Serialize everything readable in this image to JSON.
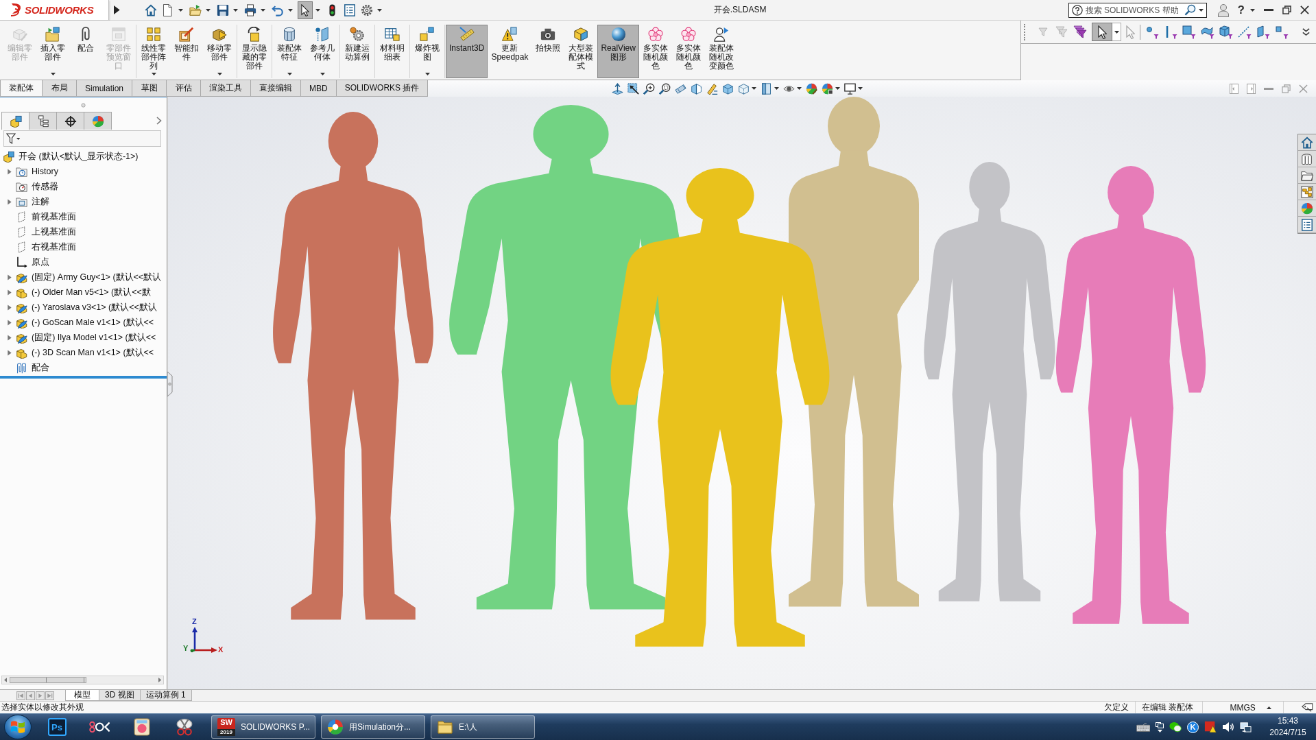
{
  "title_bar": {
    "logo": "SOLIDWORKS",
    "quick_access": [
      {
        "dropdown": false,
        "on": false
      },
      {
        "dropdown": true,
        "on": false
      },
      {
        "dropdown": true,
        "on": false
      },
      {
        "dropdown": true,
        "on": false
      },
      {
        "dropdown": true,
        "on": false
      },
      {
        "dropdown": true,
        "on": false
      },
      {
        "dropdown": true,
        "on": true
      },
      {
        "dropdown": false,
        "on": false
      },
      {
        "dropdown": false,
        "on": false
      },
      {
        "dropdown": true,
        "on": false
      }
    ],
    "title": "开会.SLDASM",
    "search": {
      "placeholder": "搜索 SOLIDWORKS 帮助"
    },
    "help": "?"
  },
  "command_manager": {
    "groups": [
      {
        "buttons": [
          {
            "label": "编辑零部件",
            "disabled": true,
            "dropdown": false,
            "on": false
          },
          {
            "label": "插入零部件",
            "disabled": false,
            "dropdown": true,
            "on": false
          },
          {
            "label": "配合",
            "disabled": false,
            "dropdown": false,
            "on": false
          },
          {
            "label": "零部件预览窗口",
            "disabled": true,
            "dropdown": false,
            "on": false
          }
        ]
      },
      {
        "buttons": [
          {
            "label": "线性零部件阵列",
            "disabled": false,
            "dropdown": true,
            "on": false
          },
          {
            "label": "智能扣件",
            "disabled": false,
            "dropdown": false,
            "on": false
          },
          {
            "label": "移动零部件",
            "disabled": false,
            "dropdown": true,
            "on": false
          }
        ]
      },
      {
        "buttons": [
          {
            "label": "显示隐藏的零部件",
            "disabled": false,
            "dropdown": false,
            "on": false
          }
        ]
      },
      {
        "buttons": [
          {
            "label": "装配体特征",
            "disabled": false,
            "dropdown": true,
            "on": false
          },
          {
            "label": "参考几何体",
            "disabled": false,
            "dropdown": true,
            "on": false
          }
        ]
      },
      {
        "buttons": [
          {
            "label": "新建运动算例",
            "disabled": false,
            "dropdown": false,
            "on": false
          }
        ]
      },
      {
        "buttons": [
          {
            "label": "材料明细表",
            "disabled": false,
            "dropdown": false,
            "on": false
          }
        ]
      },
      {
        "buttons": [
          {
            "label": "爆炸视图",
            "disabled": false,
            "dropdown": true,
            "on": false
          }
        ]
      },
      {
        "buttons": [
          {
            "label": "Instant3D",
            "disabled": false,
            "dropdown": false,
            "on": true
          },
          {
            "label": "更新Speedpak",
            "disabled": false,
            "dropdown": false,
            "on": false
          },
          {
            "label": "拍快照",
            "disabled": false,
            "dropdown": false,
            "on": false
          },
          {
            "label": "大型装配体模式",
            "disabled": false,
            "dropdown": false,
            "on": false
          },
          {
            "label": "RealView图形",
            "disabled": false,
            "dropdown": false,
            "on": true
          },
          {
            "label": "多实体随机颜色",
            "disabled": false,
            "dropdown": false,
            "on": false
          },
          {
            "label": "多实体随机颜色",
            "disabled": false,
            "dropdown": false,
            "on": false
          },
          {
            "label": "装配体随机改变颜色",
            "disabled": false,
            "dropdown": false,
            "on": false
          }
        ]
      }
    ],
    "tabs": [
      {
        "label": "装配体",
        "selected": true
      },
      {
        "label": "布局",
        "selected": false
      },
      {
        "label": "Simulation",
        "selected": false
      },
      {
        "label": "草图",
        "selected": false
      },
      {
        "label": "评估",
        "selected": false
      },
      {
        "label": "渲染工具",
        "selected": false
      },
      {
        "label": "直接编辑",
        "selected": false
      },
      {
        "label": "MBD",
        "selected": false
      },
      {
        "label": "SOLIDWORKS 插件",
        "selected": false
      }
    ]
  },
  "selection_filter": {
    "buttons": [
      {
        "disabled": true,
        "on": false,
        "dropdown": false
      },
      {
        "disabled": true,
        "on": false,
        "dropdown": false
      },
      {
        "disabled": false,
        "on": false,
        "dropdown": false
      },
      {
        "disabled": false,
        "on": true,
        "dropdown": true
      },
      {
        "disabled": true,
        "on": false,
        "dropdown": false
      },
      {
        "disabled": false,
        "on": false,
        "dropdown": false
      },
      {
        "disabled": false,
        "on": false,
        "dropdown": false
      },
      {
        "disabled": false,
        "on": false,
        "dropdown": false
      },
      {
        "disabled": false,
        "on": false,
        "dropdown": false
      },
      {
        "disabled": false,
        "on": false,
        "dropdown": false
      },
      {
        "disabled": false,
        "on": false,
        "dropdown": false
      },
      {
        "disabled": false,
        "on": false,
        "dropdown": false
      },
      {
        "disabled": false,
        "on": false,
        "dropdown": false
      }
    ]
  },
  "view_toolbar": {
    "buttons": [
      {
        "dropdown": false
      },
      {
        "dropdown": false
      },
      {
        "dropdown": false
      },
      {
        "dropdown": false
      },
      {
        "dropdown": false
      },
      {
        "dropdown": false
      },
      {
        "dropdown": false
      },
      {
        "dropdown": false
      },
      {
        "dropdown": true
      },
      {
        "dropdown": true
      },
      {
        "dropdown": true
      },
      {
        "dropdown": false
      },
      {
        "dropdown": true
      },
      {
        "dropdown": true
      }
    ]
  },
  "feature_manager": {
    "tabs": [
      {
        "selected": true
      },
      {
        "selected": false
      },
      {
        "selected": false
      },
      {
        "selected": false
      }
    ],
    "tree": {
      "label": "开会 (默认<默认_显示状态-1>)",
      "kind": "assembly",
      "children": [
        {
          "label": "History",
          "kind": "history",
          "expanded": false
        },
        {
          "label": "传感器",
          "kind": "sensors"
        },
        {
          "label": "注解",
          "kind": "annotations",
          "expanded": false
        },
        {
          "label": "前视基准面",
          "kind": "plane"
        },
        {
          "label": "上视基准面",
          "kind": "plane"
        },
        {
          "label": "右视基准面",
          "kind": "plane"
        },
        {
          "label": "原点",
          "kind": "origin"
        },
        {
          "label": "(固定) Army Guy<1> (默认<<默认",
          "kind": "component",
          "lightweight": true,
          "expanded": false
        },
        {
          "label": "(-) Older Man v5<1> (默认<<默",
          "kind": "component",
          "lightweight": false,
          "expanded": false
        },
        {
          "label": "(-) Yaroslava v3<1> (默认<<默认",
          "kind": "component",
          "lightweight": true,
          "expanded": false
        },
        {
          "label": "(-) GoScan Male v1<1> (默认<<",
          "kind": "component",
          "lightweight": true,
          "expanded": false
        },
        {
          "label": "(固定) Ilya Model v1<1> (默认<<",
          "kind": "component",
          "lightweight": true,
          "expanded": false
        },
        {
          "label": "(-) 3D Scan Man v1<1> (默认<<",
          "kind": "component",
          "lightweight": false,
          "expanded": false
        },
        {
          "label": "配合",
          "kind": "mates"
        }
      ]
    }
  },
  "viewport": {
    "models": [
      {
        "color": "#c8725c"
      },
      {
        "color": "#72d383"
      },
      {
        "color": "#e9c21c"
      },
      {
        "color": "#d1bf90"
      },
      {
        "color": "#c3c3c7"
      },
      {
        "color": "#e77cb8"
      }
    ],
    "triad": [
      "Z",
      "Y",
      "X"
    ]
  },
  "model_tabs": [
    {
      "label": "模型",
      "selected": true
    },
    {
      "label": "3D 视图",
      "selected": false
    },
    {
      "label": "运动算例 1",
      "selected": false
    }
  ],
  "status_bar": {
    "message": "选择实体以修改其外观",
    "definition": "欠定义",
    "editing": "在编辑 装配体",
    "units": "MMGS"
  },
  "taskbar": {
    "ps_icon_text": "Ps",
    "tasks": [
      {
        "label": "SOLIDWORKS P...",
        "icon_text": [
          "SW",
          "2019"
        ]
      },
      {
        "label": "用Simulation分..."
      },
      {
        "label": "E:\\人"
      }
    ],
    "tray_badge": "K",
    "time": "15:43",
    "date": "2024/7/15"
  }
}
